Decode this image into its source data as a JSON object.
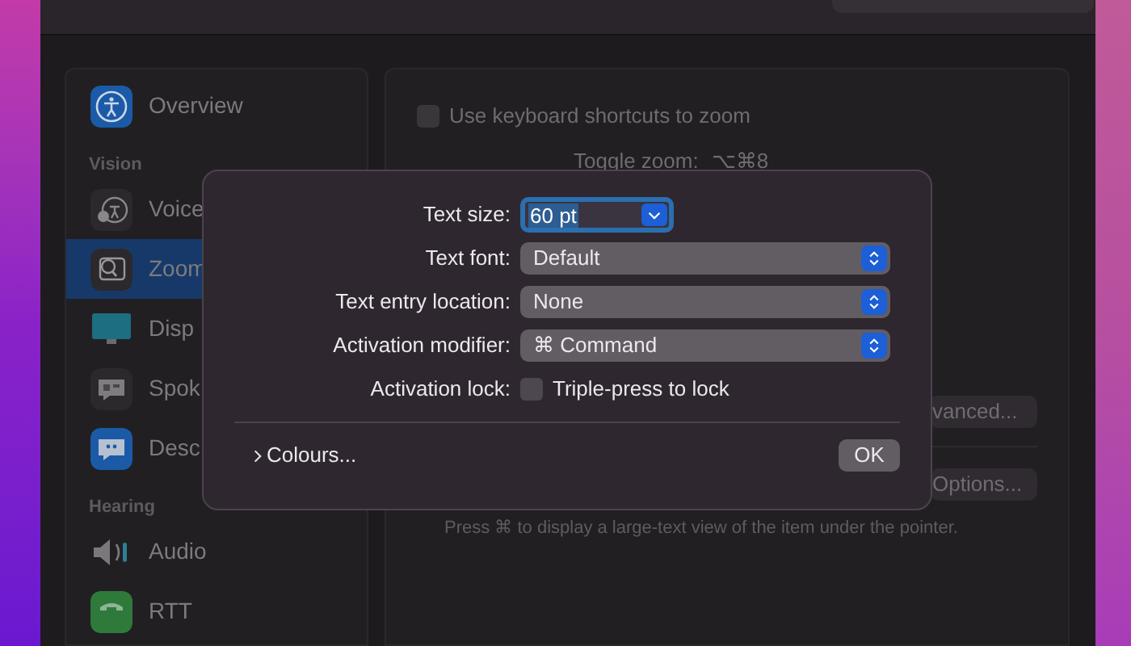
{
  "sidebar": {
    "groups": [
      {
        "items": [
          {
            "label": "Overview",
            "kind": "accessibility",
            "selected": false
          }
        ]
      },
      {
        "heading": "Vision",
        "items": [
          {
            "label": "Voice",
            "kind": "voiceover",
            "selected": false
          },
          {
            "label": "Zoom",
            "kind": "zoom",
            "selected": true
          },
          {
            "label": "Disp",
            "kind": "display",
            "selected": false
          },
          {
            "label": "Spok",
            "kind": "spoken",
            "selected": false
          },
          {
            "label": "Desc",
            "kind": "descriptions",
            "selected": false
          }
        ]
      },
      {
        "heading": "Hearing",
        "items": [
          {
            "label": "Audio",
            "kind": "audio",
            "selected": false
          },
          {
            "label": "RTT",
            "kind": "rtt",
            "selected": false
          }
        ]
      }
    ]
  },
  "content": {
    "keyboard_shortcuts": {
      "label": "Use keyboard shortcuts to zoom",
      "checked": false
    },
    "toggle_zoom": {
      "label": "Toggle zoom:",
      "value": "⌥⌘8"
    },
    "advanced_button": "vanced...",
    "options_button": "Options...",
    "hint": "Press ⌘ to display a large-text view of the item under the pointer."
  },
  "dialog": {
    "fields": [
      {
        "kind": "combo",
        "label": "Text size:",
        "value": "60 pt"
      },
      {
        "kind": "popup",
        "label": "Text font:",
        "value": "Default"
      },
      {
        "kind": "popup",
        "label": "Text entry location:",
        "value": "None"
      },
      {
        "kind": "popup",
        "label": "Activation modifier:",
        "value": "⌘ Command"
      },
      {
        "kind": "checkbox",
        "label": "Activation lock:",
        "value": "Triple-press to lock",
        "checked": false
      }
    ],
    "colours": {
      "label": "Colours...",
      "expanded": false
    },
    "ok_button": "OK"
  }
}
